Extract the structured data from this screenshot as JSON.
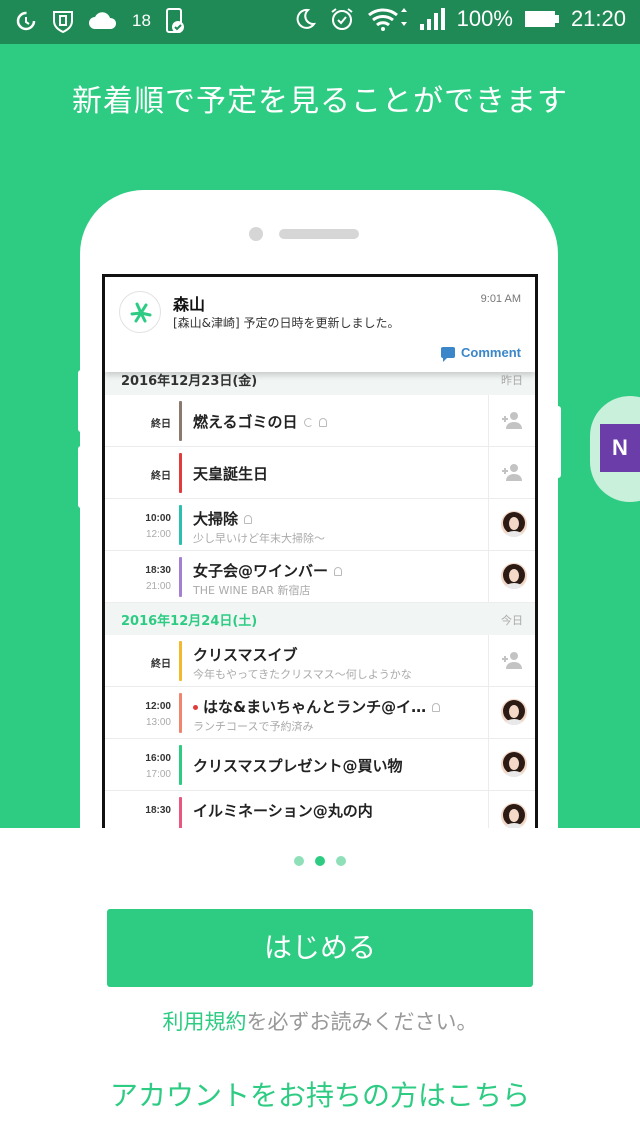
{
  "status_bar": {
    "temperature": "18",
    "battery": "100%",
    "time": "21:20",
    "icons": [
      "data-saver-icon",
      "shield-icon",
      "cloud-icon",
      "phone-check-icon",
      "moon-icon",
      "alarm-icon",
      "wifi-icon",
      "signal-icon",
      "battery-icon"
    ]
  },
  "hero": {
    "title": "新着順で予定を見ることができます",
    "background": "#2ecc83"
  },
  "notification": {
    "sender": "森山",
    "time": "9:01 AM",
    "message": "[森山&津崎] 予定の日時を更新しました。",
    "action": "Comment"
  },
  "schedule": {
    "day1": {
      "date": "2016年12月23日(金)",
      "relative": "昨日"
    },
    "day2": {
      "date": "2016年12月24日(土)",
      "relative": "今日"
    },
    "events": [
      {
        "start": "終日",
        "end": "",
        "title": "燃えるゴミの日",
        "subtitle": "",
        "color": "#8a7a6e",
        "owner": "add-person"
      },
      {
        "start": "終日",
        "end": "",
        "title": "天皇誕生日",
        "subtitle": "",
        "color": "#e03c3c",
        "owner": "add-person"
      },
      {
        "start": "10:00",
        "end": "12:00",
        "title": "大掃除",
        "subtitle": "少し早いけど年末大掃除〜",
        "color": "#2bbfb0",
        "owner": "avatar"
      },
      {
        "start": "18:30",
        "end": "21:00",
        "title": "女子会@ワインバー",
        "subtitle": "THE WINE BAR 新宿店",
        "color": "#a57fd1",
        "owner": "avatar"
      },
      {
        "start": "終日",
        "end": "",
        "title": "クリスマスイブ",
        "subtitle": "今年もやってきたクリスマス〜何しようかな",
        "color": "#f2b92b",
        "owner": "add-person"
      },
      {
        "start": "12:00",
        "end": "13:00",
        "title": "はな&まいちゃんとランチ@イ…",
        "subtitle": "ランチコースで予約済み",
        "color": "#f0856f",
        "owner": "avatar"
      },
      {
        "start": "16:00",
        "end": "17:00",
        "title": "クリスマスプレゼント@買い物",
        "subtitle": "",
        "color": "#2ecc83",
        "owner": "avatar"
      },
      {
        "start": "18:30",
        "end": "",
        "title": "イルミネーション@丸の内",
        "subtitle": "",
        "color": "#e8577d",
        "owner": "avatar"
      }
    ]
  },
  "side_badge": {
    "letter": "N"
  },
  "pager": {
    "count": 3,
    "active": 2
  },
  "buttons": {
    "start": "はじめる"
  },
  "terms": {
    "link": "利用規約",
    "text": "を必ずお読みください。"
  },
  "account_link": "アカウントをお持ちの方はこちら"
}
